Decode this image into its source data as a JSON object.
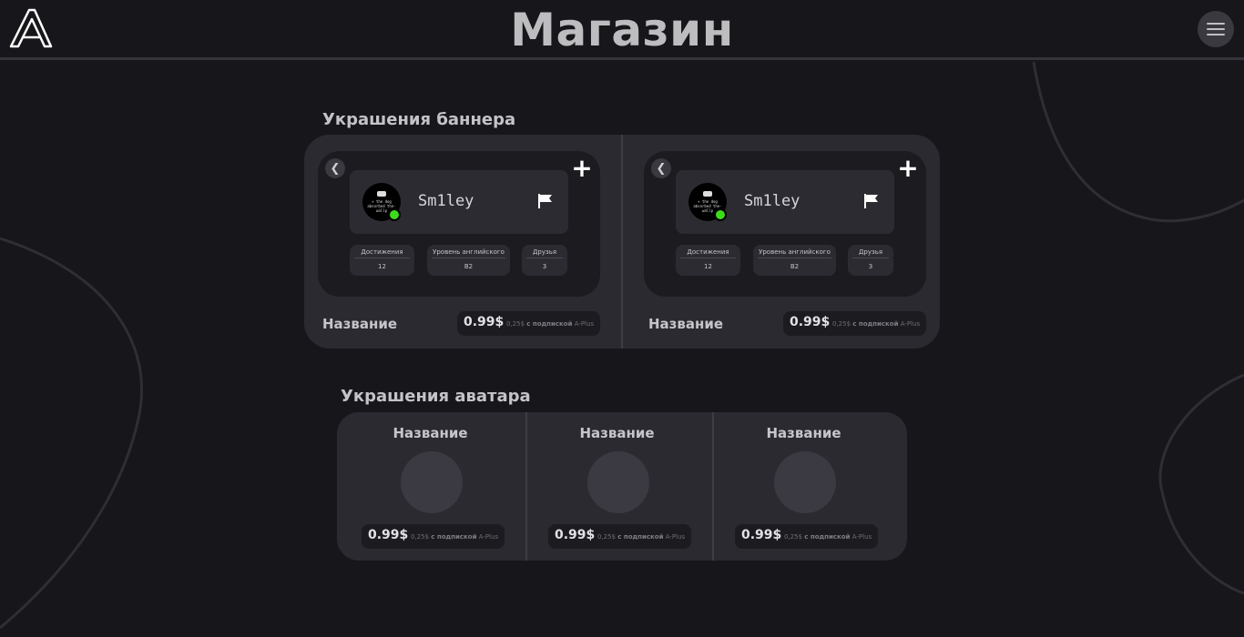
{
  "header": {
    "title": "Магазин",
    "logo_icon": "a-logo-icon",
    "menu_icon": "hamburger-menu-icon"
  },
  "banner_section": {
    "title": "Украшения баннера",
    "items": [
      {
        "username": "Sm1ley",
        "avatar_caption": "+ the dog absorbed the-wallp",
        "stats": [
          {
            "label": "Достижения",
            "value": "12"
          },
          {
            "label": "Уровень английского",
            "value": "B2"
          },
          {
            "label": "Друзья",
            "value": "3"
          }
        ],
        "name": "Название",
        "price": "0.99$",
        "price_note_prefix": "0,25$ ",
        "price_note_bold": "с подпиской",
        "price_note_suffix": " A-Plus"
      },
      {
        "username": "Sm1ley",
        "avatar_caption": "+ the dog absorbed the-wallp",
        "stats": [
          {
            "label": "Достижения",
            "value": "12"
          },
          {
            "label": "Уровень английского",
            "value": "B2"
          },
          {
            "label": "Друзья",
            "value": "3"
          }
        ],
        "name": "Название",
        "price": "0.99$",
        "price_note_prefix": "0,25$ ",
        "price_note_bold": "с подпиской",
        "price_note_suffix": " A-Plus"
      }
    ]
  },
  "avatar_section": {
    "title": "Украшения аватара",
    "items": [
      {
        "name": "Название",
        "price": "0.99$",
        "price_note_prefix": "0,25$ ",
        "price_note_bold": "с подпиской",
        "price_note_suffix": " A-Plus"
      },
      {
        "name": "Название",
        "price": "0.99$",
        "price_note_prefix": "0,25$ ",
        "price_note_bold": "с подпиской",
        "price_note_suffix": " A-Plus"
      },
      {
        "name": "Название",
        "price": "0.99$",
        "price_note_prefix": "0,25$ ",
        "price_note_bold": "с подпиской",
        "price_note_suffix": " A-Plus"
      }
    ]
  },
  "colors": {
    "background": "#17161b",
    "panel": "#2b2a31",
    "online": "#3ddc1a"
  }
}
